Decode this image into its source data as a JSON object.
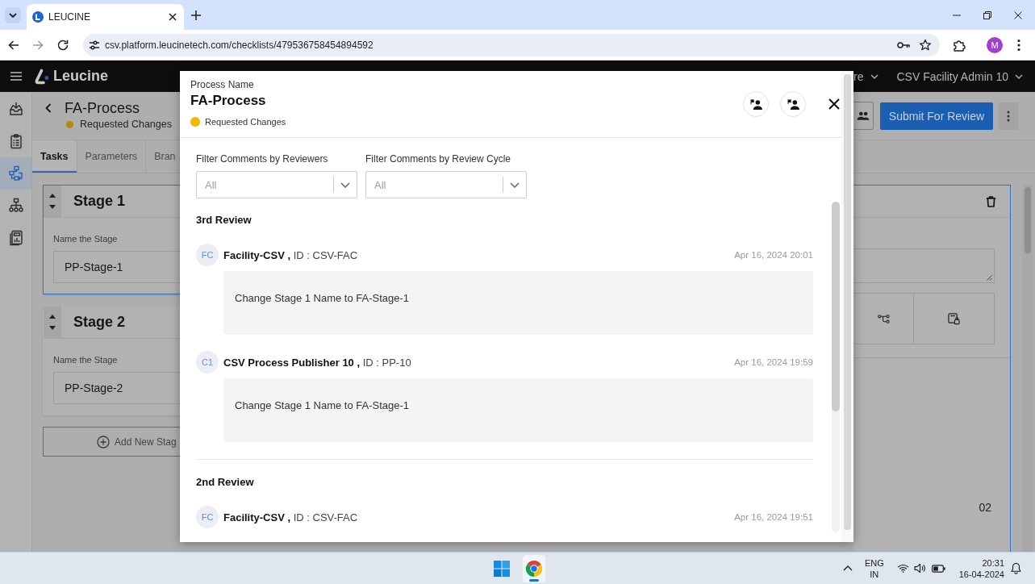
{
  "browser": {
    "tabs": [
      {
        "title": "LEUCINE",
        "selected": true
      }
    ],
    "url": "csv.platform.leucinetech.com/checklists/479536758454894592",
    "profile_initial": "M"
  },
  "app_header": {
    "logo": "Leucine",
    "menus": [
      {
        "label": "re"
      },
      {
        "label": "CSV Facility Admin 10"
      }
    ]
  },
  "sidebar": {
    "items": [
      {
        "selected": false
      },
      {
        "selected": false
      },
      {
        "selected": true
      },
      {
        "selected": false
      },
      {
        "selected": false
      }
    ]
  },
  "page": {
    "title": "FA-Process",
    "status": {
      "label": "Requested Changes",
      "color": "#b38a14"
    },
    "submit_button": "Submit For Review"
  },
  "tabs": [
    {
      "label": "Tasks",
      "selected": true
    },
    {
      "label": "Parameters",
      "selected": false
    },
    {
      "label": "Bran",
      "selected": false
    }
  ],
  "stages": [
    {
      "title": "Stage 1",
      "field_label": "Name the Stage",
      "value": "PP-Stage-1",
      "selected": true
    },
    {
      "title": "Stage 2",
      "field_label": "Name the Stage",
      "value": "PP-Stage-2",
      "selected": false
    }
  ],
  "add_stage_button": "Add New Stag",
  "task_panel": {
    "selected": true,
    "footer_text": "02"
  },
  "modal": {
    "eyebrow": "Process Name",
    "title": "FA-Process",
    "status": {
      "label": "Requested Changes",
      "color": "#f7b500"
    },
    "filters": [
      {
        "label": "Filter Comments by Reviewers",
        "placeholder": "All"
      },
      {
        "label": "Filter Comments by Review Cycle",
        "placeholder": "All"
      }
    ],
    "reviews": [
      {
        "title": "3rd Review",
        "comments": [
          {
            "initials": "FC",
            "author": "**Facility-CSV ,** ID : CSV-FAC",
            "time": "Apr 16, 2024 20:01",
            "body": "Change Stage 1 Name to FA-Stage-1"
          },
          {
            "initials": "C1",
            "author": "**CSV Process Publisher 10 ,** ID : PP-10",
            "time": "Apr 16, 2024 19:59",
            "body": "Change Stage 1 Name to FA-Stage-1"
          }
        ]
      },
      {
        "title": "2nd Review",
        "comments": [
          {
            "initials": "FC",
            "author": "**Facility-CSV ,** ID : CSV-FAC",
            "time": "Apr 16, 2024 19:51"
          }
        ]
      }
    ]
  },
  "taskbar": {
    "apps": [
      {
        "kind": "start",
        "active": false
      },
      {
        "kind": "browser",
        "active": true
      }
    ],
    "language": "ENG",
    "region": "IN",
    "time": "20:31",
    "date": "16-04-2024"
  }
}
